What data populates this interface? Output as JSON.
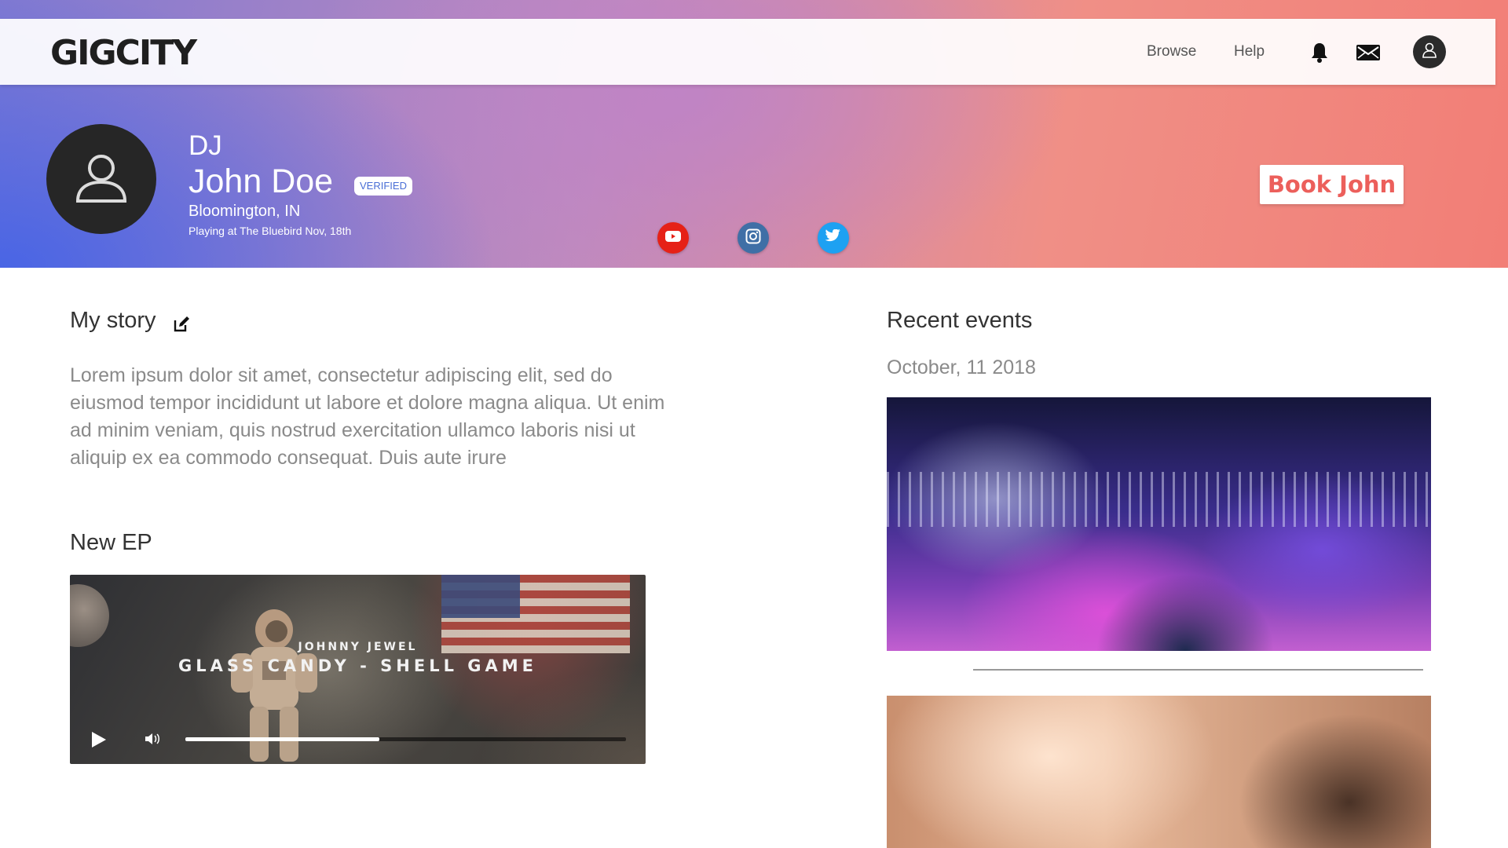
{
  "brand": {
    "logo": "GIGCITY"
  },
  "nav": {
    "links": [
      {
        "label": "Browse"
      },
      {
        "label": "Help"
      }
    ],
    "icons": [
      "bell-icon",
      "mail-icon",
      "user-icon"
    ]
  },
  "profile": {
    "role": "DJ",
    "name": "John Doe",
    "badge": "VERIFIED",
    "location": "Bloomington, IN",
    "next_show": "Playing at The Bluebird Nov, 18th",
    "book_label": "Book John",
    "social": [
      {
        "icon": "youtube-icon",
        "color": "#e62117"
      },
      {
        "icon": "instagram-icon",
        "color": "#3f6fa6"
      },
      {
        "icon": "twitter-icon",
        "color": "#1da1f2"
      }
    ]
  },
  "story": {
    "title": "My story",
    "body": "Lorem ipsum dolor sit amet, consectetur adipiscing elit, sed do eiusmod tempor incididunt ut labore et dolore magna aliqua. Ut enim ad minim veniam, quis nostrud exercitation ullamco laboris nisi ut aliquip ex ea commodo consequat. Duis aute irure"
  },
  "ep": {
    "title": "New EP",
    "artist": "JOHNNY JEWEL",
    "track": "GLASS CANDY - SHELL GAME",
    "progress": 0.44
  },
  "events": {
    "title": "Recent events",
    "items": [
      {
        "date": "October, 11 2018"
      }
    ]
  },
  "colors": {
    "accent": "#ec5f5b",
    "verified": "#4a6fd6"
  }
}
